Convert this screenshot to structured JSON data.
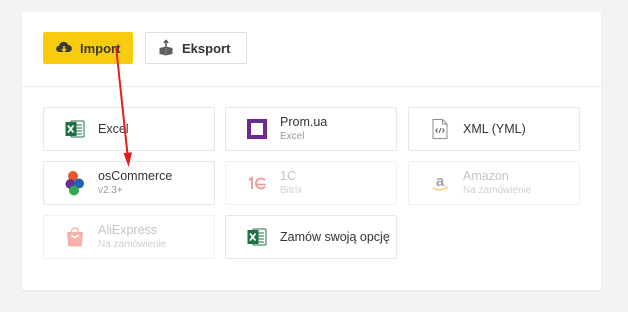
{
  "toolbar": {
    "import_label": "Import",
    "export_label": "Eksport"
  },
  "colors": {
    "import_bg": "#f7cc10",
    "annotation_arrow": "#e31e1e",
    "excel_green": "#1e7145",
    "prom_purple": "#6b2c91",
    "onec_red": "#d93025",
    "amazon_orange": "#ff9900",
    "aliexpress_red": "#e9573f"
  },
  "icons": {
    "import": "cloud-download-icon",
    "export": "box-upload-icon",
    "excel": "excel-icon",
    "prom": "prom-ua-icon",
    "xml": "xml-file-icon",
    "oscommerce": "oscommerce-icon",
    "onec": "1c-icon",
    "amazon": "amazon-icon",
    "aliexpress": "aliexpress-icon",
    "custom": "excel-icon"
  },
  "sources": [
    {
      "name": "Excel",
      "sub": ""
    },
    {
      "name": "Prom.ua",
      "sub": "Excel"
    },
    {
      "name": "XML (YML)",
      "sub": ""
    },
    {
      "name": "osCommerce",
      "sub": "v2.3+"
    },
    {
      "name": "1C",
      "sub": "Bitrix"
    },
    {
      "name": "Amazon",
      "sub": "Na zamówienie"
    },
    {
      "name": "AliExpress",
      "sub": "Na zamówienie"
    },
    {
      "name": "Zamów swoją opcję",
      "sub": ""
    }
  ]
}
